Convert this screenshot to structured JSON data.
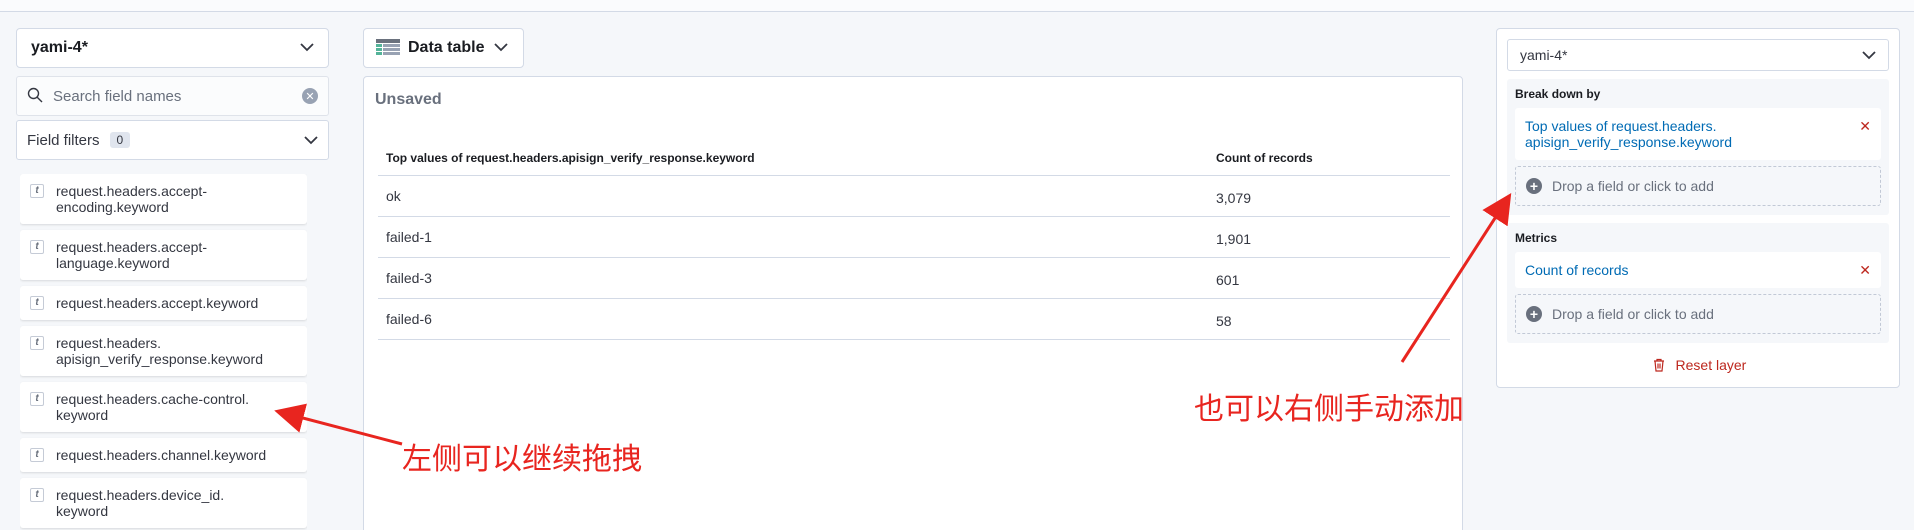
{
  "left": {
    "index_pattern": "yami-4*",
    "search_placeholder": "Search field names",
    "field_filters_label": "Field filters",
    "field_filters_count": "0",
    "fields": [
      {
        "type": "t",
        "line1": "request.headers.accept-",
        "line2": "encoding.keyword"
      },
      {
        "type": "t",
        "line1": "request.headers.accept-",
        "line2": "language.keyword"
      },
      {
        "type": "t",
        "line1": "request.headers.accept.keyword",
        "line2": ""
      },
      {
        "type": "t",
        "line1": "request.headers.",
        "line2": "apisign_verify_response.keyword"
      },
      {
        "type": "t",
        "line1": "request.headers.cache-control.",
        "line2": "keyword"
      },
      {
        "type": "t",
        "line1": "request.headers.channel.keyword",
        "line2": ""
      },
      {
        "type": "t",
        "line1": "request.headers.device_id.",
        "line2": "keyword"
      }
    ]
  },
  "center": {
    "viz_type": "Data table",
    "title": "Unsaved",
    "table": {
      "headers": [
        "Top values of request.headers.apisign_verify_response.keyword",
        "Count of records"
      ],
      "rows": [
        [
          "ok",
          "3,079"
        ],
        [
          "failed-1",
          "1,901"
        ],
        [
          "failed-3",
          "601"
        ],
        [
          "failed-6",
          "58"
        ]
      ]
    }
  },
  "right": {
    "layer_index": "yami-4*",
    "break_down_title": "Break down by",
    "break_down_field_line1": "Top values of request.headers.",
    "break_down_field_line2": "apisign_verify_response.keyword",
    "drop_label": "Drop a field or click to add",
    "metrics_title": "Metrics",
    "metric_field": "Count of records",
    "reset_label": "Reset layer"
  },
  "annotations": {
    "left_note": "左侧可以继续拖拽",
    "right_note": "也可以右侧手动添加",
    "color": "#e8251f"
  },
  "colors": {
    "link": "#006bb4",
    "danger": "#bd271e",
    "background": "#f5f7fa"
  }
}
